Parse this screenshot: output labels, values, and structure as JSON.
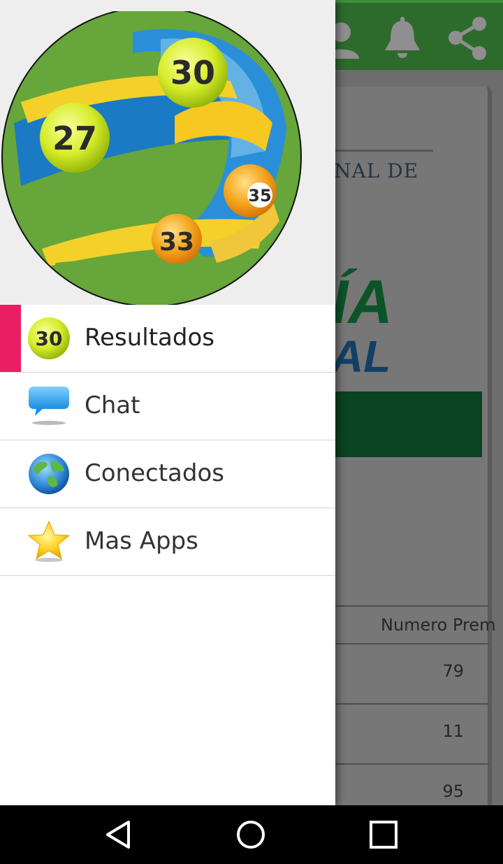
{
  "background_app": {
    "header_text": "NAL DE",
    "logo_line1": "ÍA",
    "logo_line2": "AL",
    "table_header": "Numero Prem",
    "table_values": [
      "79",
      "11",
      "95"
    ],
    "toolbar_icons": [
      "account-icon",
      "bell-icon",
      "share-icon"
    ],
    "colors": {
      "toolbar": "#2d6b2d",
      "green_bar": "#0a4322"
    }
  },
  "drawer": {
    "header_balls": [
      {
        "number": "30",
        "style": "yellow-green"
      },
      {
        "number": "27",
        "style": "yellow-green"
      },
      {
        "number": "35",
        "style": "orange"
      },
      {
        "number": "33",
        "style": "orange"
      }
    ],
    "active_index": 0,
    "active_color": "#e91e63",
    "items": [
      {
        "label": "Resultados",
        "icon": "lottery-ball-30-icon",
        "icon_text": "30"
      },
      {
        "label": "Chat",
        "icon": "chat-bubble-icon"
      },
      {
        "label": "Conectados",
        "icon": "globe-icon"
      },
      {
        "label": "Mas Apps",
        "icon": "star-icon"
      }
    ]
  },
  "navbar": {
    "buttons": [
      "back-icon",
      "home-icon",
      "recents-icon"
    ]
  }
}
